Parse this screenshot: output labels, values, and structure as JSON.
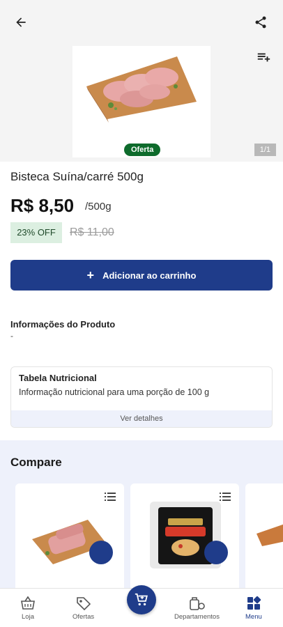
{
  "header": {
    "back_icon": "arrow-left-icon",
    "share_icon": "share-icon",
    "list_add_icon": "playlist-add-icon"
  },
  "gallery": {
    "offer_badge": "Oferta",
    "counter": "1/1"
  },
  "product": {
    "title": "Bisteca Suína/carré 500g",
    "price": "R$ 8,50",
    "unit": "/500g",
    "discount": "23% OFF",
    "old_price": "R$ 11,00",
    "add_to_cart_label": "Adicionar ao carrinho"
  },
  "info": {
    "title": "Informações do Produto",
    "value": "-"
  },
  "nutrition": {
    "title": "Tabela Nutricional",
    "subtitle": "Informação nutricional para uma porção de 100 g",
    "details_link": "Ver detalhes"
  },
  "compare": {
    "title": "Compare"
  },
  "bottom_nav": {
    "items": [
      {
        "label": "Loja",
        "icon": "basket-icon"
      },
      {
        "label": "Ofertas",
        "icon": "tag-icon"
      },
      {
        "label": "Departamentos",
        "icon": "departments-icon"
      },
      {
        "label": "Menu",
        "icon": "grid-menu-icon"
      }
    ]
  },
  "colors": {
    "primary": "#1f3c8a",
    "offer_green": "#0e6b2c",
    "discount_bg": "#dcefe1",
    "compare_bg": "#eef1fb"
  }
}
